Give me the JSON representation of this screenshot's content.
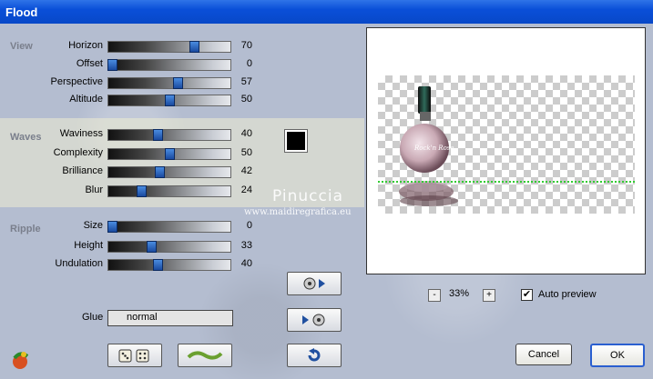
{
  "window": {
    "title": "Flood"
  },
  "sections": {
    "view": "View",
    "waves": "Waves",
    "ripple": "Ripple"
  },
  "sliders": [
    {
      "id": "horizon",
      "label": "Horizon",
      "value": "70",
      "pos": 0.7
    },
    {
      "id": "offset",
      "label": "Offset",
      "value": "0",
      "pos": 0.03
    },
    {
      "id": "perspective",
      "label": "Perspective",
      "value": "57",
      "pos": 0.57
    },
    {
      "id": "altitude",
      "label": "Altitude",
      "value": "50",
      "pos": 0.5
    },
    {
      "id": "waviness",
      "label": "Waviness",
      "value": "40",
      "pos": 0.4
    },
    {
      "id": "complexity",
      "label": "Complexity",
      "value": "50",
      "pos": 0.5
    },
    {
      "id": "brilliance",
      "label": "Brilliance",
      "value": "42",
      "pos": 0.42
    },
    {
      "id": "blur",
      "label": "Blur",
      "value": "24",
      "pos": 0.27
    },
    {
      "id": "size",
      "label": "Size",
      "value": "0",
      "pos": 0.03
    },
    {
      "id": "height",
      "label": "Height",
      "value": "33",
      "pos": 0.35
    },
    {
      "id": "undulation",
      "label": "Undulation",
      "value": "40",
      "pos": 0.4
    }
  ],
  "glue": {
    "label": "Glue",
    "value": "normal"
  },
  "zoom": {
    "minus": "-",
    "value": "33%",
    "plus": "+"
  },
  "auto_preview": {
    "label": "Auto preview",
    "checked": "✔"
  },
  "buttons": {
    "cancel": "Cancel",
    "ok": "OK"
  },
  "watermark": {
    "name": "Pinuccia",
    "url": "www.maidiregrafica.eu"
  },
  "colors": {
    "swatch": "#000000",
    "title_bar": "#0a4fd8"
  }
}
